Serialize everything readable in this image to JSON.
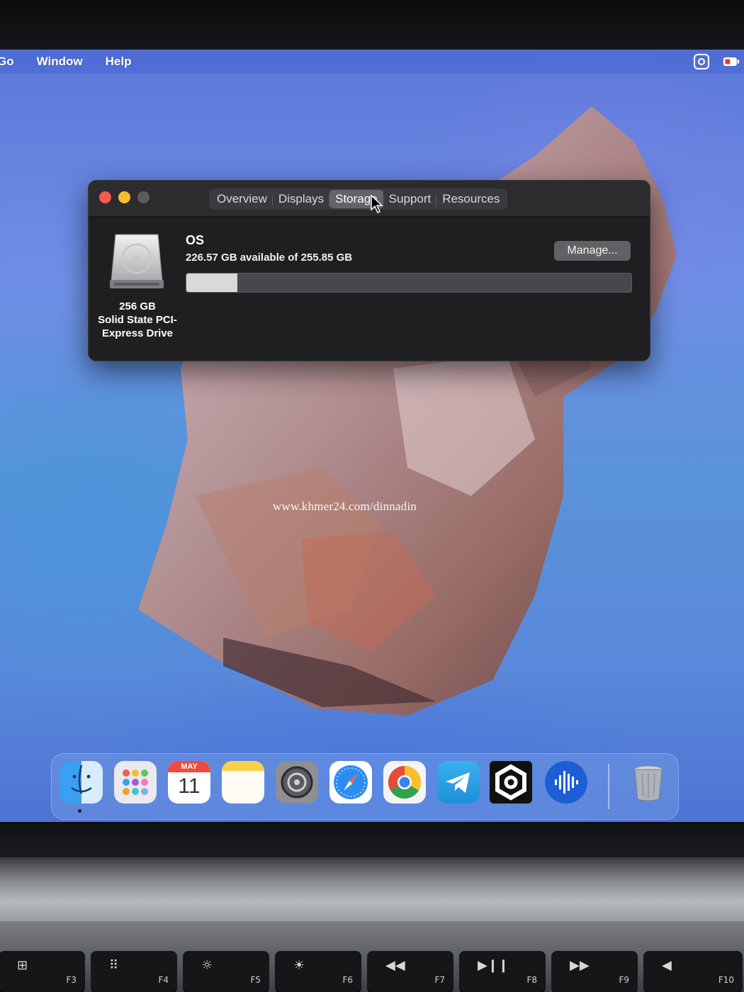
{
  "menubar": {
    "items": [
      "Go",
      "Window",
      "Help"
    ]
  },
  "window": {
    "tabs": [
      {
        "label": "Overview",
        "active": false
      },
      {
        "label": "Displays",
        "active": false
      },
      {
        "label": "Storage",
        "active": true
      },
      {
        "label": "Support",
        "active": false
      },
      {
        "label": "Resources",
        "active": false
      }
    ],
    "drive": {
      "caption_line1": "256 GB",
      "caption_line2": "Solid State PCI-",
      "caption_line3": "Express Drive"
    },
    "volume": {
      "name": "OS",
      "availability": "226.57 GB available of 255.85 GB",
      "used_fraction": 0.115,
      "manage_label": "Manage..."
    }
  },
  "watermark": "www.khmer24.com/dinnadin",
  "dock": {
    "apps": [
      "finder-icon",
      "launchpad-icon",
      "calendar-icon",
      "notes-icon",
      "system-preferences-icon",
      "safari-icon",
      "chrome-icon",
      "telegram-icon",
      "vpn-app-icon",
      "audio-app-icon",
      "trash-icon"
    ],
    "calendar": {
      "month": "MAY",
      "day": "11"
    }
  },
  "keyboard": {
    "keys": [
      {
        "glyph": "⊞",
        "label": "F3"
      },
      {
        "glyph": "⠿",
        "label": "F4"
      },
      {
        "glyph": "☼",
        "label": "F5"
      },
      {
        "glyph": "☀",
        "label": "F6"
      },
      {
        "glyph": "◀◀",
        "label": "F7"
      },
      {
        "glyph": "▶❙❙",
        "label": "F8"
      },
      {
        "glyph": "▶▶",
        "label": "F9"
      },
      {
        "glyph": "◀",
        "label": "F10"
      }
    ]
  }
}
